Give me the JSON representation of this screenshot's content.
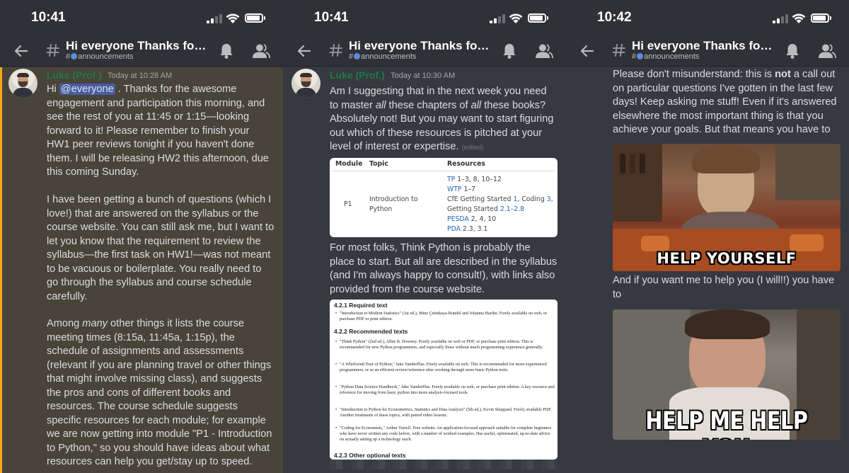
{
  "status_bar": {
    "times": [
      "10:41",
      "10:41",
      "10:42"
    ]
  },
  "channel": {
    "title": "Hi everyone Thanks for...",
    "subtitle": "announcements",
    "hash_prefix": "#"
  },
  "colors": {
    "background": "#36393f",
    "header": "#2f3136",
    "highlight": "#49443a",
    "highlight_border": "#faa61a",
    "author": "#1c7a45",
    "mention": "#4a5d9c",
    "link": "#2466b9"
  },
  "icons": {
    "back": "back-arrow-icon",
    "channel": "hash-icon",
    "bell": "bell-icon",
    "members": "members-icon"
  },
  "panel1": {
    "author": "Luke (Prof.)",
    "timestamp": "Today at 10:28 AM",
    "greeting": "Hi",
    "mention": "@everyone",
    "para1": ". Thanks for the awesome engagement and participation this morning, and see the rest of you at 11:45 or 1:15—looking forward to it! Please remember to finish your HW1 peer reviews tonight if you haven't done them. I will be releasing HW2 this afternoon, due this coming Sunday.",
    "para2": "I have been getting a bunch of questions (which I love!) that are answered on the syllabus or the course website. You can still ask me, but I want to let you know that the requirement to review the syllabus—the first task on HW1!—was not meant to be vacuous or boilerplate. You really need to go through the syllabus and course schedule carefully.",
    "para3_before": "Among ",
    "para3_em": "many",
    "para3_after": " other things it lists the course meeting times (8:15a, 11:45a, 1:15p), the schedule of assignments and assessments (relevant if you are planning travel or other things that might involve missing class), and suggests the pros and cons of different books and resources. The course schedule suggests specific resources for each module; for example we are now getting into module \"P1 - Introduction to Python,\" so you should have ideas about what resources can help you get/stay up to speed."
  },
  "panel2": {
    "author": "Luke (Prof.)",
    "timestamp": "Today at 10:30 AM",
    "p1_a": "Am I suggesting that in the next week you need to master ",
    "p1_em1": "all",
    "p1_b": " these chapters of ",
    "p1_em2": "all",
    "p1_c": " these books? Absolutely not! But you may want to start figuring out which of these resources is pitched at your level of interest or expertise.",
    "edited": "(edited)",
    "table": {
      "headers": [
        "Module",
        "Topic",
        "Resources"
      ],
      "module": "P1",
      "topic": "Introduction to Python",
      "r1_link": "TP",
      "r1_rest": " 1–3, 8, 10–12",
      "r2_link": "WTP",
      "r2_rest": " 1–7",
      "r3_a": "CfE Getting Started ",
      "r3_l1": "1",
      "r3_b": ", Coding ",
      "r3_l2": "3",
      "r3_c": ",",
      "r4_a": "Getting Started ",
      "r4_l": "2.1–2.8",
      "r5_link": "PESDA",
      "r5_rest": " 2, 4, 10",
      "r6_link": "PDA",
      "r6_rest": " 2.3, 3.1"
    },
    "p2": "For most folks, Think Python is probably the place to start. But all are described in the syllabus (and I'm always happy to consult!), with links also provided from the course website.",
    "doc": {
      "h1": "4.2.1  Required text",
      "i1": "\"Introduction to Modern Statistics\" (1st ed.), Mine Çetinkaya-Rundel and Johanna Hardin. Freely available on web, or purchase PDF or print edition.",
      "h2": "4.2.2  Recommended texts",
      "i2": "\"Think Python\" (2nd ed.), Allen B. Downey. Freely available on web or PDF, or purchase print edition. This is recommended for new Python programmers, and especially those without much programming experience generally.",
      "i3": "\"A Whirlwind Tour of Python,\" Jake VanderPlas. Freely available on web. This is recommended for more experienced programmers, or as an efficient review/reference after working through more basic Python texts.",
      "i4": "\"Python Data Science Handbook,\" Jake VanderPlas. Freely available on web, or purchase print edition. A key resource and reference for moving from basic python into more analysis-focused tools.",
      "i5": "\"Introduction to Python for Econometrics, Statistics and Data Analysis\" (5th ed.), Kevin Sheppard. Freely available PDF. Another treatments of these topics, with paired video lessons.",
      "i6": "\"Coding for Economists,\" Arthur Turrell. Free website. An application-focused approach suitable for complete beginners who have never written any code before, with a number of worked examples. Has useful, opinionated, up-to-date advice on actually setting up a technology stack.",
      "h3": "4.2.3  Other optional texts"
    }
  },
  "panel3": {
    "p1_a": "Please don't misunderstand: this is ",
    "p1_bold": "not",
    "p1_b": " a call out on particular questions I've gotten in the last few days! Keep asking me stuff! Even if it's answered elsewhere the most important thing is that you achieve your goals. But that means you have to",
    "gif1_caption": "HELP YOURSELF",
    "p2": "And if you want me to help you (I will!!) you have to",
    "gif2_caption": "HELP ME HELP YOU"
  }
}
